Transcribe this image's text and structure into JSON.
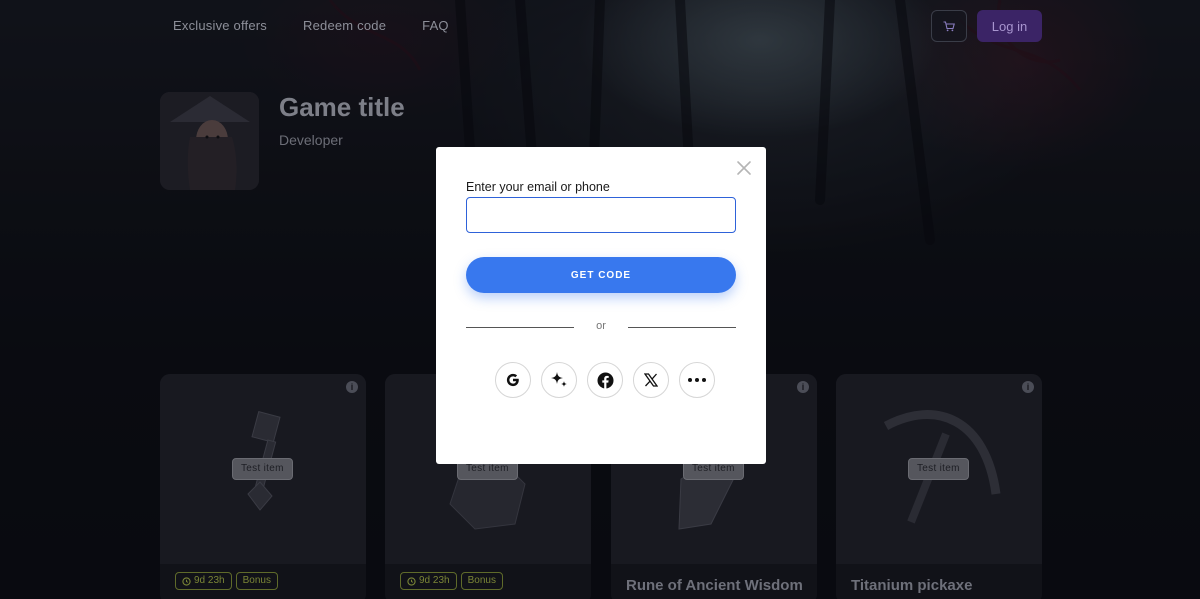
{
  "nav": {
    "items": [
      {
        "label": "Exclusive offers"
      },
      {
        "label": "Redeem code"
      },
      {
        "label": "FAQ"
      }
    ],
    "login_label": "Log in",
    "cart_icon": "cart-icon"
  },
  "game": {
    "title": "Game title",
    "developer": "Developer"
  },
  "cards": [
    {
      "tag": "Test item",
      "badges": [
        "9d 23h",
        "Bonus"
      ],
      "name": ""
    },
    {
      "tag": "Test item",
      "badges": [
        "9d 23h",
        "Bonus"
      ],
      "name": ""
    },
    {
      "tag": "Test item",
      "badges": [],
      "name": "Rune of Ancient Wisdom"
    },
    {
      "tag": "Test item",
      "badges": [],
      "name": "Titanium pickaxe"
    }
  ],
  "modal": {
    "field_label": "Enter your email or phone",
    "field_value": "",
    "button_label": "GET CODE",
    "or_label": "or",
    "socials": [
      "google-icon",
      "sparkle-icon",
      "facebook-icon",
      "x-icon",
      "more-icon"
    ]
  },
  "colors": {
    "primary_button": "#3878ee",
    "input_border": "#2e62d9",
    "login_button": "#3b2466",
    "badge_text": "#7a8536"
  }
}
